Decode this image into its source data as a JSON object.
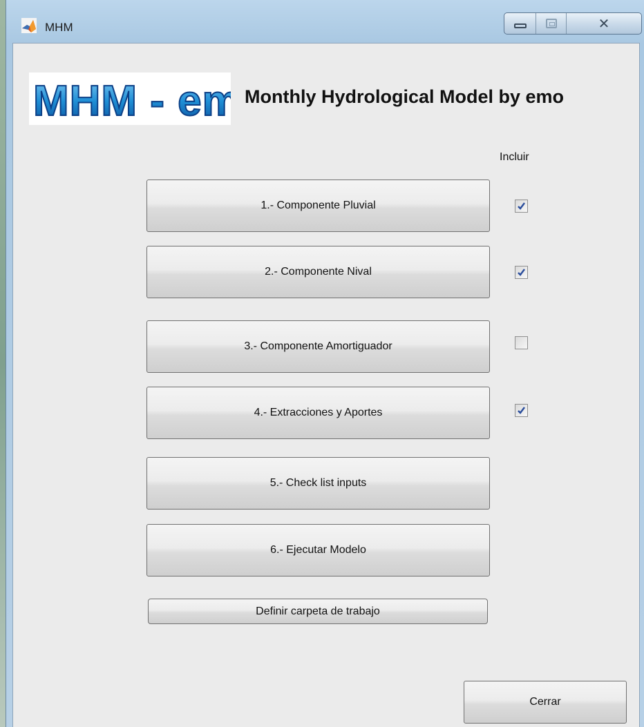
{
  "window": {
    "title": "MHM",
    "controls": {
      "minimize": "minimize",
      "maximize": "maximize",
      "close": "close"
    }
  },
  "header": {
    "logo_text": "MHM - emo",
    "title": "Monthly Hydrological Model by emo"
  },
  "include_label": "Incluir",
  "steps": [
    {
      "label": "1.- Componente Pluvial",
      "included": true
    },
    {
      "label": "2.- Componente Nival",
      "included": true
    },
    {
      "label": "3.- Componente Amortiguador",
      "included": false
    },
    {
      "label": "4.- Extracciones y Aportes",
      "included": true
    },
    {
      "label": "5.- Check list inputs"
    },
    {
      "label": "6.- Ejecutar Modelo"
    }
  ],
  "folder_button": "Definir carpeta de trabajo",
  "close_button": "Cerrar",
  "colors": {
    "logo_blue": "#1f8fd6",
    "logo_dark": "#0b3f86",
    "checkmark": "#2a4d9c"
  }
}
